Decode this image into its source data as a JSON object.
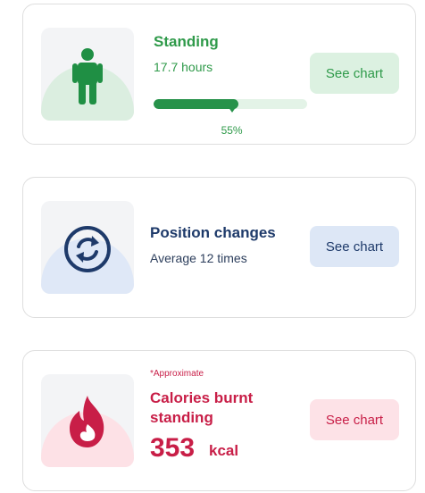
{
  "standing": {
    "title": "Standing",
    "hours": "17.7 hours",
    "progress_fraction": 0.55,
    "progress_label": "55%",
    "button_label": "See chart",
    "icon": "standing-person-icon",
    "accent": "#2f9a4a"
  },
  "position": {
    "title": "Position changes",
    "subtitle": "Average 12 times",
    "button_label": "See chart",
    "icon": "position-change-icon",
    "accent": "#1e3a6a"
  },
  "calories": {
    "note": "*Approximate",
    "title": "Calories burnt standing",
    "value": "353",
    "unit": "kcal",
    "button_label": "See chart",
    "icon": "flame-icon",
    "accent": "#c81e47"
  }
}
